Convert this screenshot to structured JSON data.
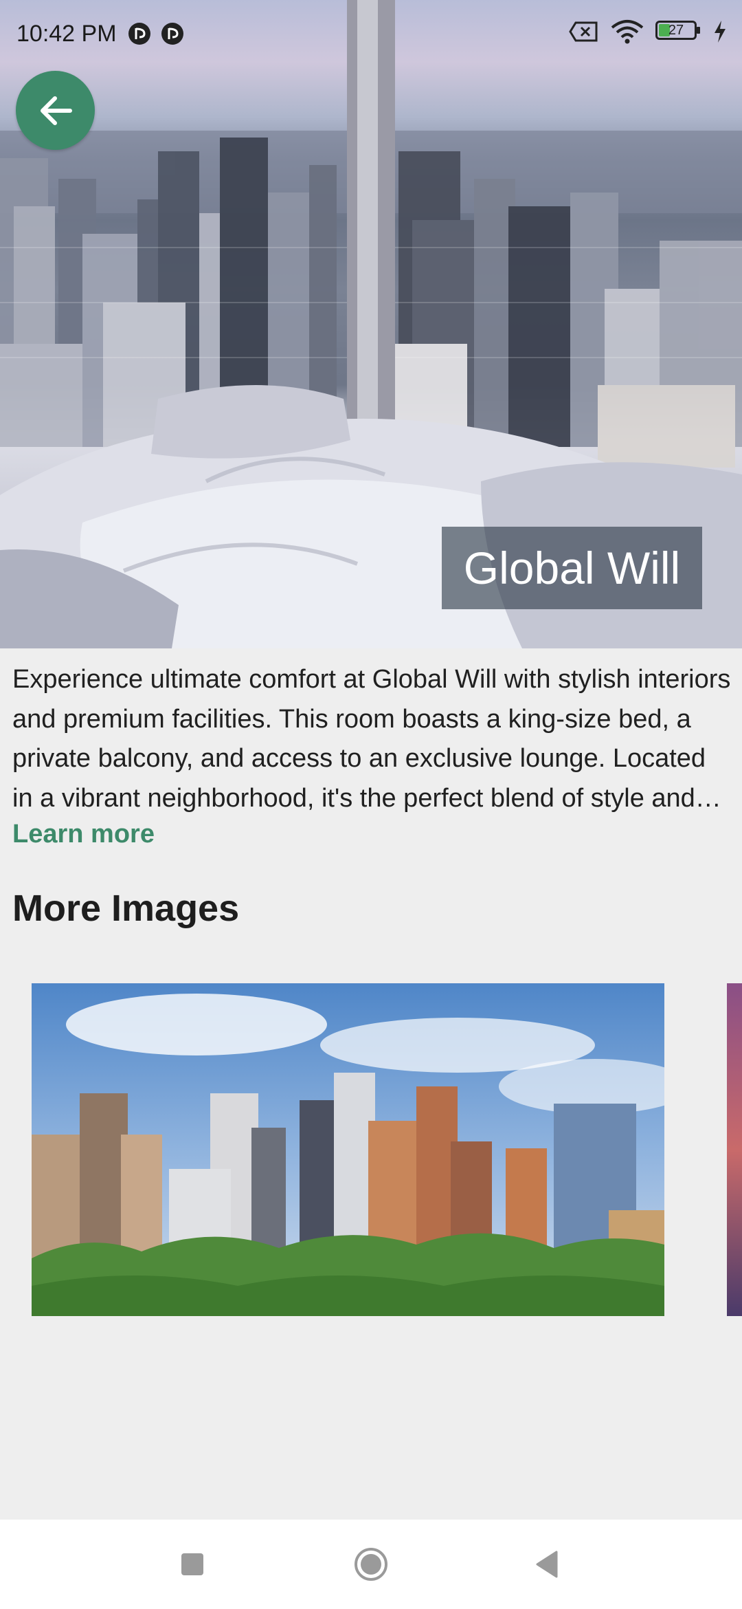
{
  "status_bar": {
    "time": "10:42 PM",
    "battery_level": "27",
    "icons": [
      "sync-icon",
      "sync-icon",
      "battery-alert-icon",
      "wifi-icon",
      "battery-icon",
      "charging-icon"
    ]
  },
  "hero": {
    "title": "Global Will",
    "back_icon": "arrow-left-icon",
    "accent_color": "#3d8a6a"
  },
  "description": {
    "text": "Experience ultimate comfort at Global Will with stylish interiors and premium facilities. This room boasts a king-size bed, a private balcony, and access to an exclusive lounge. Located in a vibrant neighborhood, it's the perfect blend of style and convenience.",
    "learn_more_label": "Learn more"
  },
  "more_images": {
    "title": "More Images"
  },
  "nav_bar": {
    "icons": [
      "recents-square-icon",
      "home-circle-icon",
      "back-triangle-icon"
    ]
  }
}
